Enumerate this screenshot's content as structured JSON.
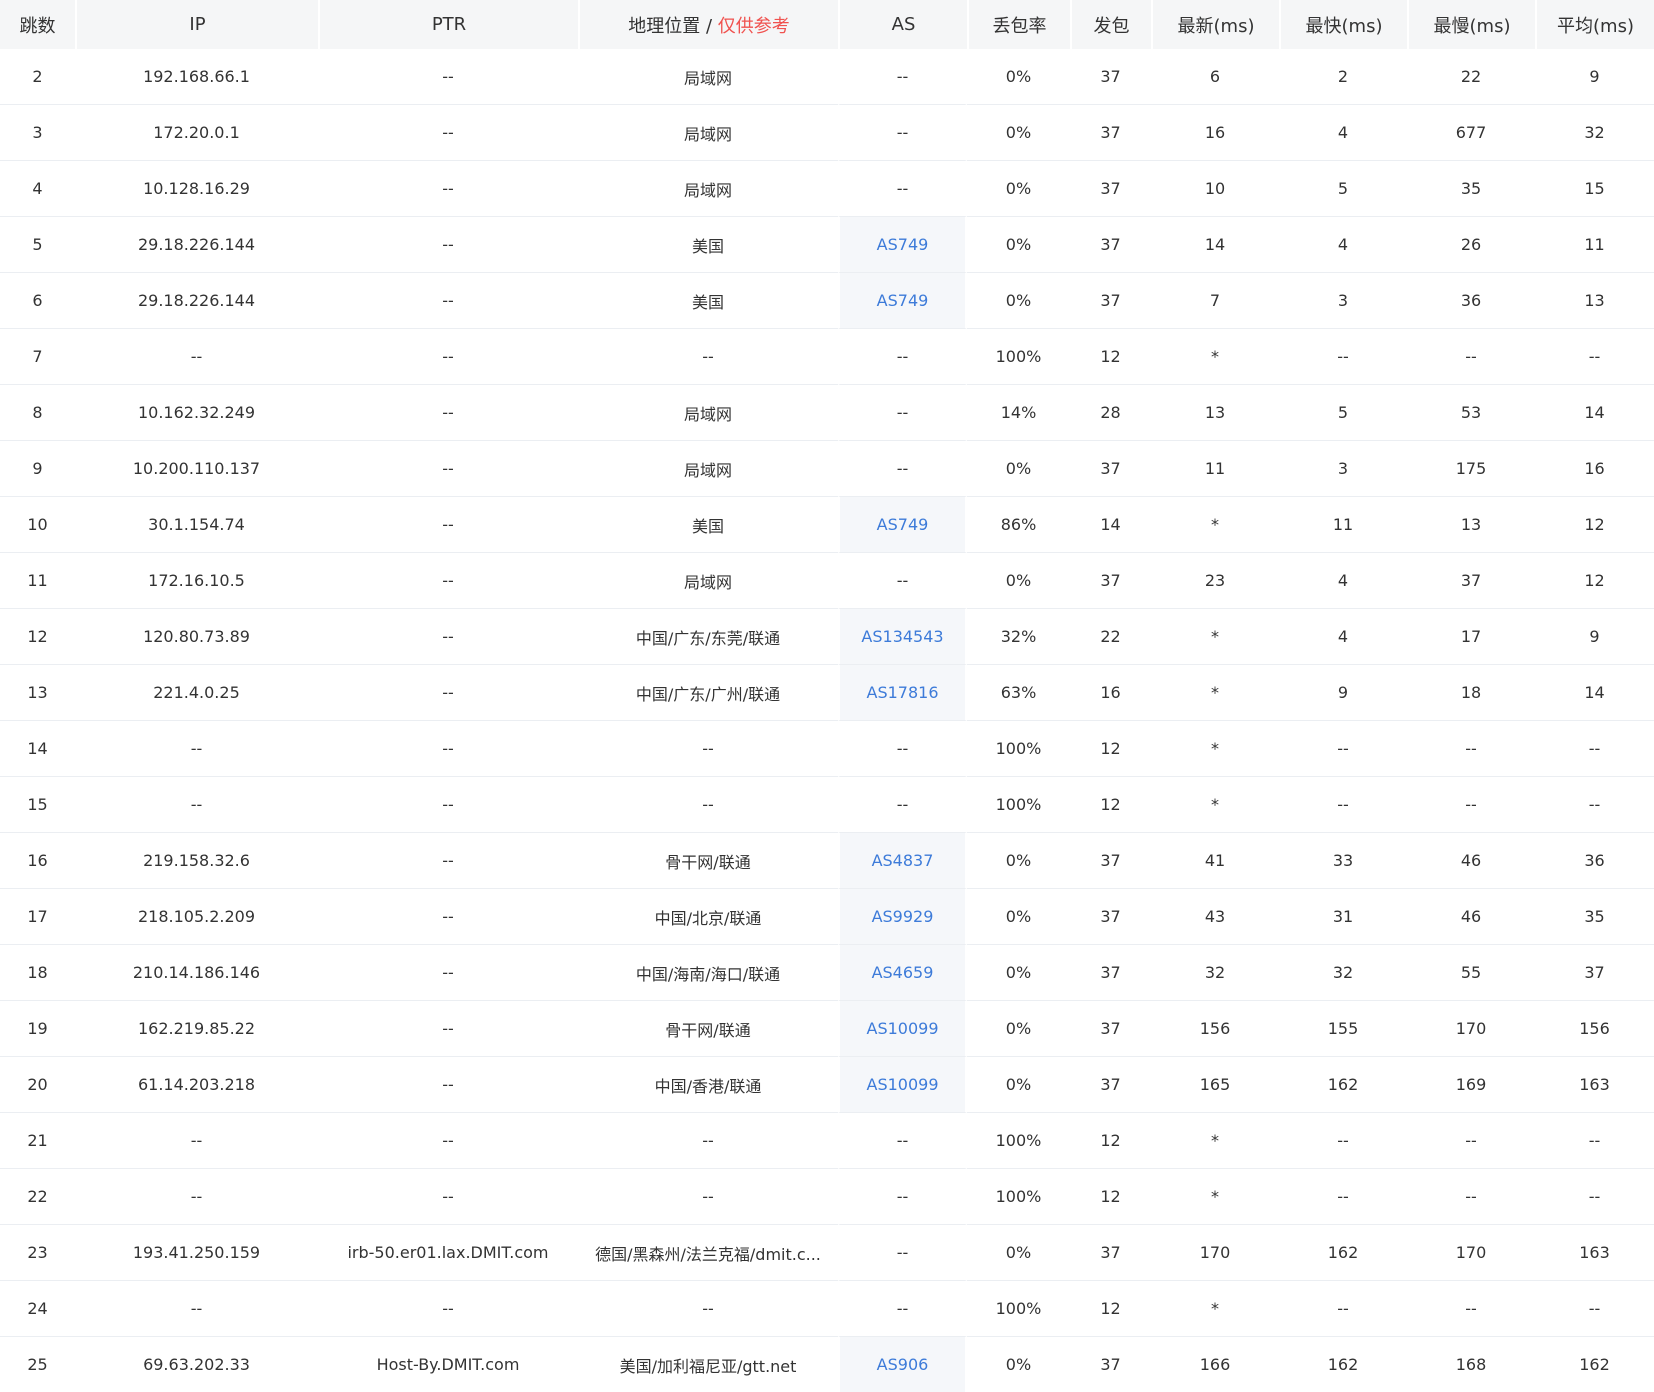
{
  "columns": [
    "跳数",
    "IP",
    "PTR",
    "地理位置",
    "AS",
    "丢包率",
    "发包",
    "最新(ms)",
    "最快(ms)",
    "最慢(ms)",
    "平均(ms)"
  ],
  "geo_header_sep": " / ",
  "geo_header_note": "仅供参考",
  "colors": {
    "link": "#3d7bd9",
    "note": "#f0524f",
    "header_bg": "#f5f6f7"
  },
  "rows": [
    {
      "hop": "2",
      "ip": "192.168.66.1",
      "ptr": "--",
      "geo": "局域网",
      "as": "--",
      "loss": "0%",
      "sent": "37",
      "last": "6",
      "best": "2",
      "worst": "22",
      "avg": "9"
    },
    {
      "hop": "3",
      "ip": "172.20.0.1",
      "ptr": "--",
      "geo": "局域网",
      "as": "--",
      "loss": "0%",
      "sent": "37",
      "last": "16",
      "best": "4",
      "worst": "677",
      "avg": "32"
    },
    {
      "hop": "4",
      "ip": "10.128.16.29",
      "ptr": "--",
      "geo": "局域网",
      "as": "--",
      "loss": "0%",
      "sent": "37",
      "last": "10",
      "best": "5",
      "worst": "35",
      "avg": "15"
    },
    {
      "hop": "5",
      "ip": "29.18.226.144",
      "ptr": "--",
      "geo": "美国",
      "as": "AS749",
      "loss": "0%",
      "sent": "37",
      "last": "14",
      "best": "4",
      "worst": "26",
      "avg": "11"
    },
    {
      "hop": "6",
      "ip": "29.18.226.144",
      "ptr": "--",
      "geo": "美国",
      "as": "AS749",
      "loss": "0%",
      "sent": "37",
      "last": "7",
      "best": "3",
      "worst": "36",
      "avg": "13"
    },
    {
      "hop": "7",
      "ip": "--",
      "ptr": "--",
      "geo": "--",
      "as": "--",
      "loss": "100%",
      "sent": "12",
      "last": "*",
      "best": "--",
      "worst": "--",
      "avg": "--"
    },
    {
      "hop": "8",
      "ip": "10.162.32.249",
      "ptr": "--",
      "geo": "局域网",
      "as": "--",
      "loss": "14%",
      "sent": "28",
      "last": "13",
      "best": "5",
      "worst": "53",
      "avg": "14"
    },
    {
      "hop": "9",
      "ip": "10.200.110.137",
      "ptr": "--",
      "geo": "局域网",
      "as": "--",
      "loss": "0%",
      "sent": "37",
      "last": "11",
      "best": "3",
      "worst": "175",
      "avg": "16"
    },
    {
      "hop": "10",
      "ip": "30.1.154.74",
      "ptr": "--",
      "geo": "美国",
      "as": "AS749",
      "loss": "86%",
      "sent": "14",
      "last": "*",
      "best": "11",
      "worst": "13",
      "avg": "12"
    },
    {
      "hop": "11",
      "ip": "172.16.10.5",
      "ptr": "--",
      "geo": "局域网",
      "as": "--",
      "loss": "0%",
      "sent": "37",
      "last": "23",
      "best": "4",
      "worst": "37",
      "avg": "12"
    },
    {
      "hop": "12",
      "ip": "120.80.73.89",
      "ptr": "--",
      "geo": "中国/广东/东莞/联通",
      "as": "AS134543",
      "loss": "32%",
      "sent": "22",
      "last": "*",
      "best": "4",
      "worst": "17",
      "avg": "9"
    },
    {
      "hop": "13",
      "ip": "221.4.0.25",
      "ptr": "--",
      "geo": "中国/广东/广州/联通",
      "as": "AS17816",
      "loss": "63%",
      "sent": "16",
      "last": "*",
      "best": "9",
      "worst": "18",
      "avg": "14"
    },
    {
      "hop": "14",
      "ip": "--",
      "ptr": "--",
      "geo": "--",
      "as": "--",
      "loss": "100%",
      "sent": "12",
      "last": "*",
      "best": "--",
      "worst": "--",
      "avg": "--"
    },
    {
      "hop": "15",
      "ip": "--",
      "ptr": "--",
      "geo": "--",
      "as": "--",
      "loss": "100%",
      "sent": "12",
      "last": "*",
      "best": "--",
      "worst": "--",
      "avg": "--"
    },
    {
      "hop": "16",
      "ip": "219.158.32.6",
      "ptr": "--",
      "geo": "骨干网/联通",
      "as": "AS4837",
      "loss": "0%",
      "sent": "37",
      "last": "41",
      "best": "33",
      "worst": "46",
      "avg": "36"
    },
    {
      "hop": "17",
      "ip": "218.105.2.209",
      "ptr": "--",
      "geo": "中国/北京/联通",
      "as": "AS9929",
      "loss": "0%",
      "sent": "37",
      "last": "43",
      "best": "31",
      "worst": "46",
      "avg": "35"
    },
    {
      "hop": "18",
      "ip": "210.14.186.146",
      "ptr": "--",
      "geo": "中国/海南/海口/联通",
      "as": "AS4659",
      "loss": "0%",
      "sent": "37",
      "last": "32",
      "best": "32",
      "worst": "55",
      "avg": "37"
    },
    {
      "hop": "19",
      "ip": "162.219.85.22",
      "ptr": "--",
      "geo": "骨干网/联通",
      "as": "AS10099",
      "loss": "0%",
      "sent": "37",
      "last": "156",
      "best": "155",
      "worst": "170",
      "avg": "156"
    },
    {
      "hop": "20",
      "ip": "61.14.203.218",
      "ptr": "--",
      "geo": "中国/香港/联通",
      "as": "AS10099",
      "loss": "0%",
      "sent": "37",
      "last": "165",
      "best": "162",
      "worst": "169",
      "avg": "163"
    },
    {
      "hop": "21",
      "ip": "--",
      "ptr": "--",
      "geo": "--",
      "as": "--",
      "loss": "100%",
      "sent": "12",
      "last": "*",
      "best": "--",
      "worst": "--",
      "avg": "--"
    },
    {
      "hop": "22",
      "ip": "--",
      "ptr": "--",
      "geo": "--",
      "as": "--",
      "loss": "100%",
      "sent": "12",
      "last": "*",
      "best": "--",
      "worst": "--",
      "avg": "--"
    },
    {
      "hop": "23",
      "ip": "193.41.250.159",
      "ptr": "irb-50.er01.lax.DMIT.com",
      "geo": "德国/黑森州/法兰克福/dmit.c...",
      "as": "--",
      "loss": "0%",
      "sent": "37",
      "last": "170",
      "best": "162",
      "worst": "170",
      "avg": "163"
    },
    {
      "hop": "24",
      "ip": "--",
      "ptr": "--",
      "geo": "--",
      "as": "--",
      "loss": "100%",
      "sent": "12",
      "last": "*",
      "best": "--",
      "worst": "--",
      "avg": "--"
    },
    {
      "hop": "25",
      "ip": "69.63.202.33",
      "ptr": "Host-By.DMIT.com",
      "geo": "美国/加利福尼亚/gtt.net",
      "as": "AS906",
      "loss": "0%",
      "sent": "37",
      "last": "166",
      "best": "162",
      "worst": "168",
      "avg": "162"
    }
  ]
}
